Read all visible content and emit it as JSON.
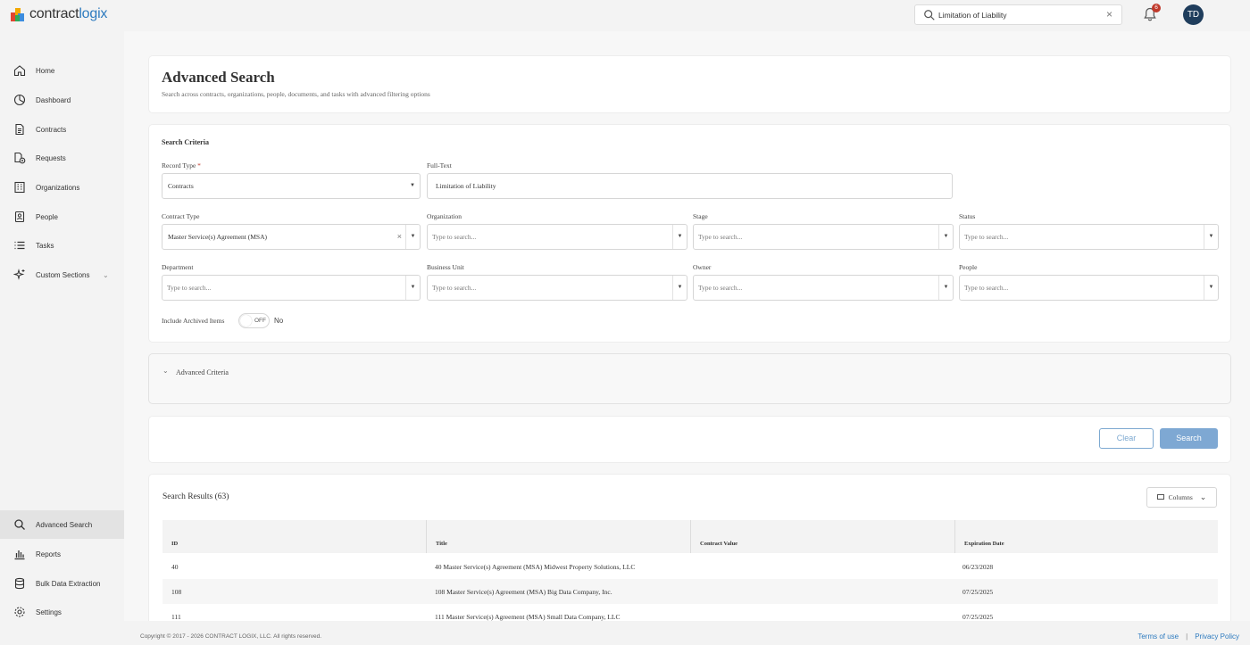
{
  "app": {
    "logo_text_main": "contract",
    "logo_text_accent": "logix",
    "search_value": "Limitation of Liability",
    "notification_count": "6",
    "avatar_initials": "TD",
    "colors": {
      "accent": "#7ea8d3",
      "link": "#2e7bbf",
      "badge": "#c0392b",
      "avatar": "#1f3d5c"
    }
  },
  "sidebar": {
    "items": [
      {
        "label": "Home",
        "icon": "home-icon"
      },
      {
        "label": "Dashboard",
        "icon": "dashboard-icon"
      },
      {
        "label": "Contracts",
        "icon": "document-icon"
      },
      {
        "label": "Requests",
        "icon": "request-icon"
      },
      {
        "label": "Organizations",
        "icon": "building-icon"
      },
      {
        "label": "People",
        "icon": "person-icon"
      },
      {
        "label": "Tasks",
        "icon": "tasks-icon"
      },
      {
        "label": "Custom Sections",
        "icon": "sparkle-icon"
      }
    ],
    "bottom_items": [
      {
        "label": "Advanced Search",
        "icon": "search-icon"
      },
      {
        "label": "Reports",
        "icon": "reports-icon"
      },
      {
        "label": "Bulk Data Extraction",
        "icon": "database-icon"
      },
      {
        "label": "Settings",
        "icon": "gear-icon"
      }
    ]
  },
  "header": {
    "title": "Advanced Search",
    "subtitle": "Search across contracts, organizations, people, documents, and tasks with advanced filtering options"
  },
  "criteria": {
    "section_title": "Search Criteria",
    "record_type": {
      "label": "Record Type",
      "required": "*",
      "value": "Contracts"
    },
    "full_text": {
      "label": "Full-Text",
      "value": "Limitation of Liability"
    },
    "contract_type": {
      "label": "Contract Type",
      "value": "Master Service(s) Agreement (MSA)"
    },
    "organization": {
      "label": "Organization",
      "placeholder": "Type to search..."
    },
    "stage": {
      "label": "Stage",
      "placeholder": "Type to search..."
    },
    "status": {
      "label": "Status",
      "placeholder": "Type to search..."
    },
    "department": {
      "label": "Department",
      "placeholder": "Type to search..."
    },
    "business_unit": {
      "label": "Business Unit",
      "placeholder": "Type to search..."
    },
    "owner": {
      "label": "Owner",
      "placeholder": "Type to search..."
    },
    "people": {
      "label": "People",
      "placeholder": "Type to search..."
    },
    "archived": {
      "label": "Include Archived Items",
      "toggle_text": "OFF",
      "state_text": "No",
      "on": false
    }
  },
  "advanced": {
    "label": "Advanced Criteria"
  },
  "actions": {
    "clear_label": "Clear",
    "search_label": "Search"
  },
  "results": {
    "title": "Search Results (63)",
    "columns_label": "Columns",
    "headers": [
      "ID",
      "Title",
      "Contract Value",
      "Expiration Date"
    ],
    "rows": [
      {
        "id": "40",
        "title": "40 Master Service(s) Agreement (MSA) Midwest Property Solutions, LLC",
        "value": "",
        "expiration": "06/23/2028"
      },
      {
        "id": "108",
        "title": "108 Master Service(s) Agreement (MSA) Big Data Company, Inc.",
        "value": "",
        "expiration": "07/25/2025"
      },
      {
        "id": "111",
        "title": "111 Master Service(s) Agreement (MSA) Small Data Company, LLC",
        "value": "",
        "expiration": "07/25/2025"
      }
    ]
  },
  "footer": {
    "copyright": "Copyright © 2017 - 2026 CONTRACT LOGIX, LLC. All rights reserved.",
    "terms": "Terms of use",
    "separator": "|",
    "privacy": "Privacy Policy"
  }
}
